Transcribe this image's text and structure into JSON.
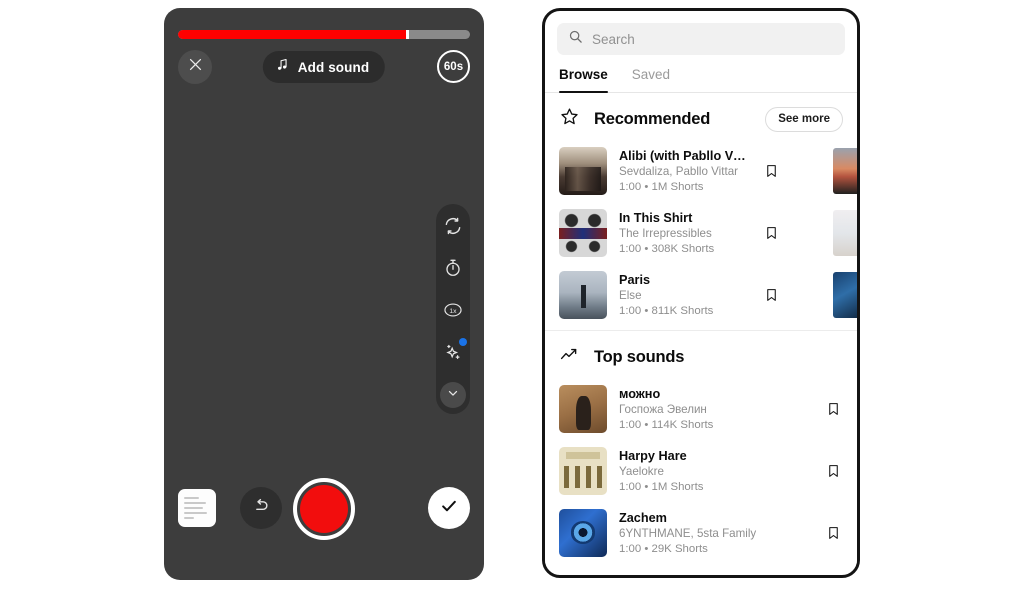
{
  "camera": {
    "progress_percent": 78,
    "close_icon": "close-icon",
    "add_sound_label": "Add sound",
    "music_note_icon": "music-note-icon",
    "duration_badge": "60s",
    "side_controls": [
      {
        "name": "flip-camera",
        "icon": "flip-camera-icon",
        "badge": false
      },
      {
        "name": "timer",
        "icon": "timer-icon",
        "badge": false
      },
      {
        "name": "speed",
        "icon": "speed-1x-icon",
        "label": "1x",
        "badge": false
      },
      {
        "name": "effects",
        "icon": "sparkle-effects-icon",
        "badge": true
      },
      {
        "name": "collapse",
        "icon": "chevron-down-icon",
        "badge": false
      }
    ],
    "bottom_controls": {
      "gallery_icon": "gallery-thumbnail-icon",
      "undo_icon": "undo-icon",
      "record_icon": "record-button",
      "confirm_icon": "checkmark-icon"
    }
  },
  "sounds": {
    "search": {
      "placeholder": "Search",
      "icon": "search-icon"
    },
    "tabs": [
      {
        "label": "Browse",
        "active": true
      },
      {
        "label": "Saved",
        "active": false
      }
    ],
    "sections": [
      {
        "id": "recommended",
        "icon": "star-icon",
        "title": "Recommended",
        "action_label": "See more",
        "has_peek_thumbs": true,
        "tracks": [
          {
            "title": "Alibi (with Pabllo Vittar & Yseult)",
            "artist": "Sevdaliza, Pabllo Vittar",
            "duration": "1:00",
            "shorts": "1M Shorts",
            "art": "art-alibi",
            "peek": "peek-sunset",
            "save_icon": "bookmark-icon"
          },
          {
            "title": "In This Shirt",
            "artist": "The Irrepressibles",
            "duration": "1:00",
            "shorts": "308K Shorts",
            "art": "art-shirt",
            "peek": "peek-pale",
            "save_icon": "bookmark-icon"
          },
          {
            "title": "Paris",
            "artist": "Else",
            "duration": "1:00",
            "shorts": "811K Shorts",
            "art": "art-paris",
            "peek": "peek-blue",
            "save_icon": "bookmark-icon"
          }
        ]
      },
      {
        "id": "top-sounds",
        "icon": "trending-up-icon",
        "title": "Top sounds",
        "action_label": "",
        "has_peek_thumbs": false,
        "tracks": [
          {
            "title": "можно",
            "artist": "Госпожа Эвелин",
            "duration": "1:00",
            "shorts": "114K Shorts",
            "art": "art-mozhno",
            "save_icon": "bookmark-icon"
          },
          {
            "title": "Harpy Hare",
            "artist": "Yaelokre",
            "duration": "1:00",
            "shorts": "1M Shorts",
            "art": "art-harpy",
            "save_icon": "bookmark-icon"
          },
          {
            "title": "Zachem",
            "artist": "6YNTHMANE, 5sta Family",
            "duration": "1:00",
            "shorts": "29K Shorts",
            "art": "art-zachem",
            "save_icon": "bookmark-icon"
          }
        ]
      }
    ],
    "separator": "•"
  },
  "colors": {
    "record_red": "#f20d0d",
    "progress_red": "#ff0000",
    "panel_dark": "#3d3d3d",
    "badge_blue": "#1a73e8"
  }
}
